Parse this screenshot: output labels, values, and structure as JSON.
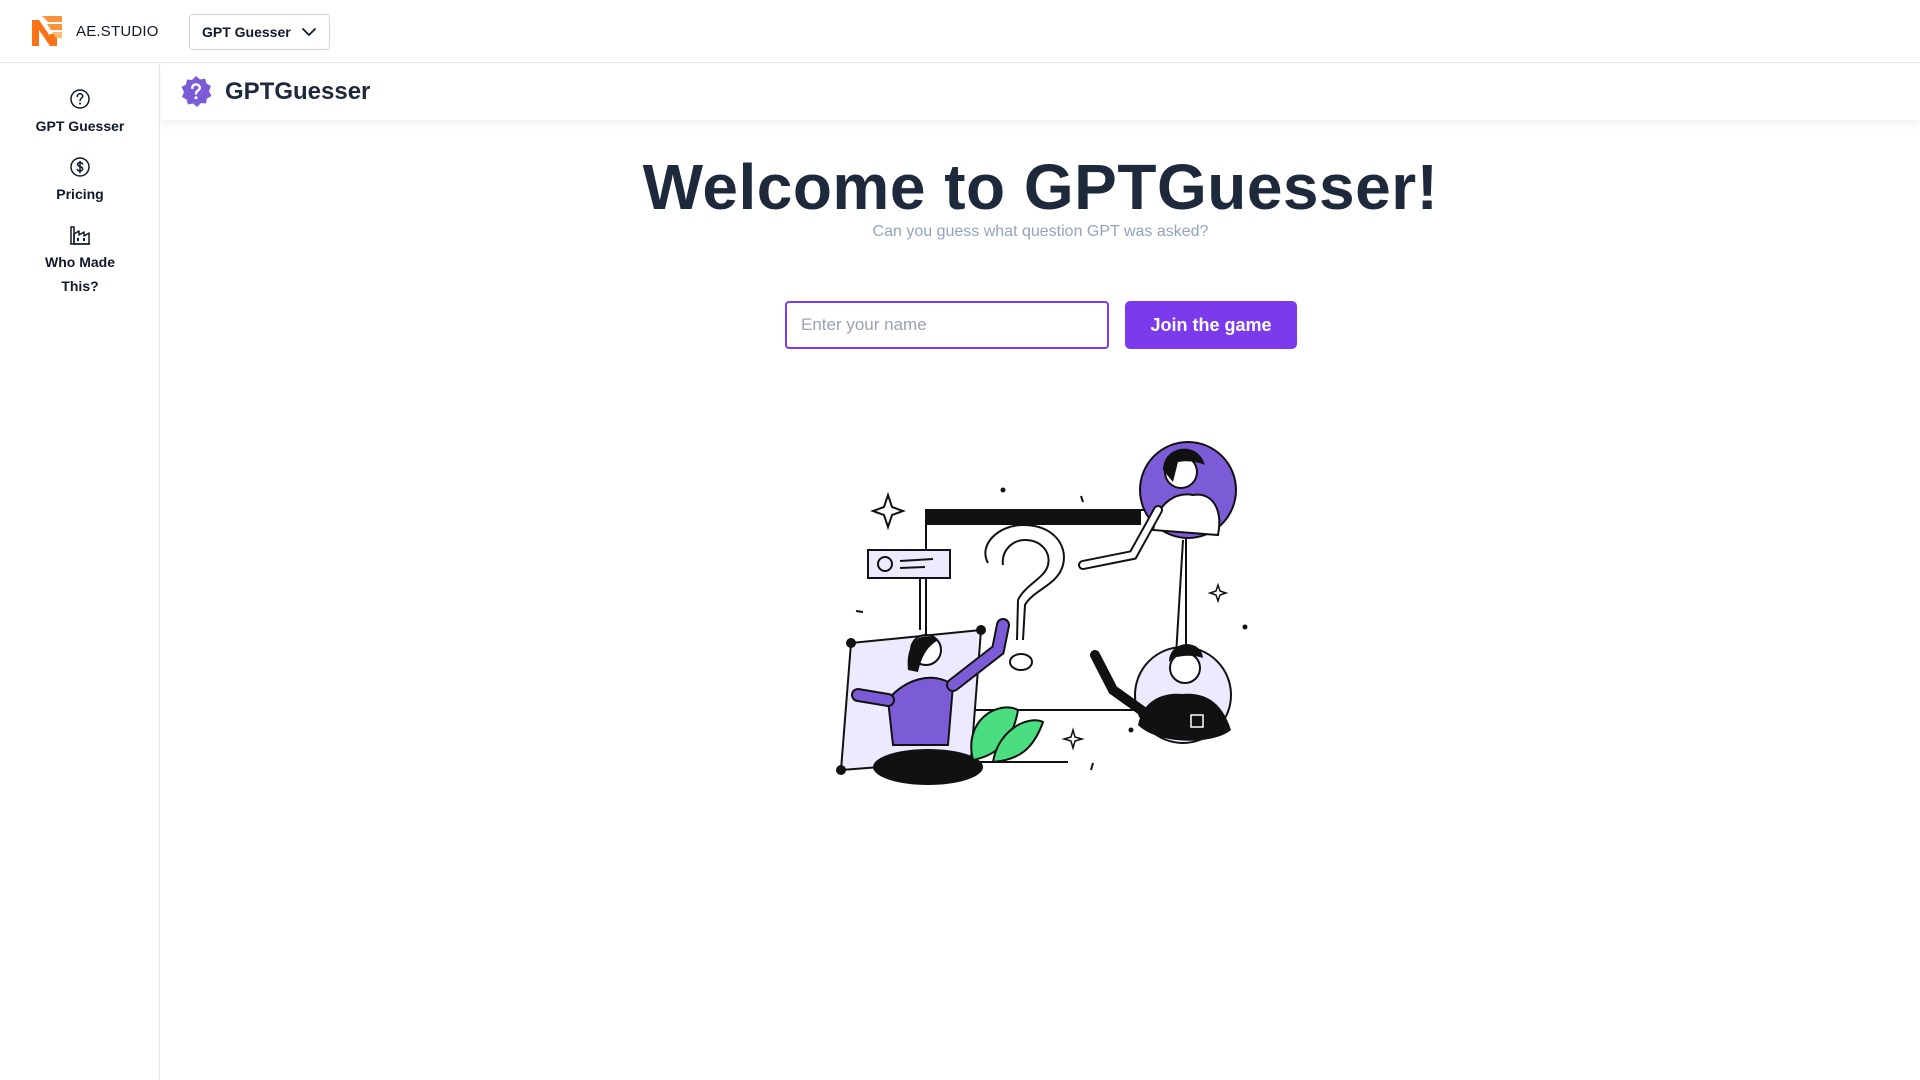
{
  "topbar": {
    "brand_name": "AE.STUDIO",
    "brand_icon": "ae-studio-logo-icon",
    "app_selector_label": "GPT Guesser",
    "app_selector_icon": "chevron-down-icon"
  },
  "sidebar": {
    "items": [
      {
        "label": "GPT Guesser",
        "icon": "question-circle-icon"
      },
      {
        "label": "Pricing",
        "icon": "dollar-circle-icon"
      },
      {
        "label": "Who Made\nThis?",
        "icon": "factory-icon"
      }
    ]
  },
  "page_header": {
    "title": "GPTGuesser",
    "icon": "purple-question-badge-icon"
  },
  "main": {
    "heading": "Welcome to GPTGuesser!",
    "subtitle": "Can you guess what question GPT was asked?",
    "name_input": {
      "value": "",
      "placeholder": "Enter your name"
    },
    "join_button_label": "Join the game"
  },
  "colors": {
    "accent": "#7c3aed",
    "heading": "#1e293b",
    "subtitle": "#94a3b8",
    "brand_orange": "#f97316",
    "leaf_green": "#4ade80",
    "illustration_lavender": "#ede9fe"
  }
}
